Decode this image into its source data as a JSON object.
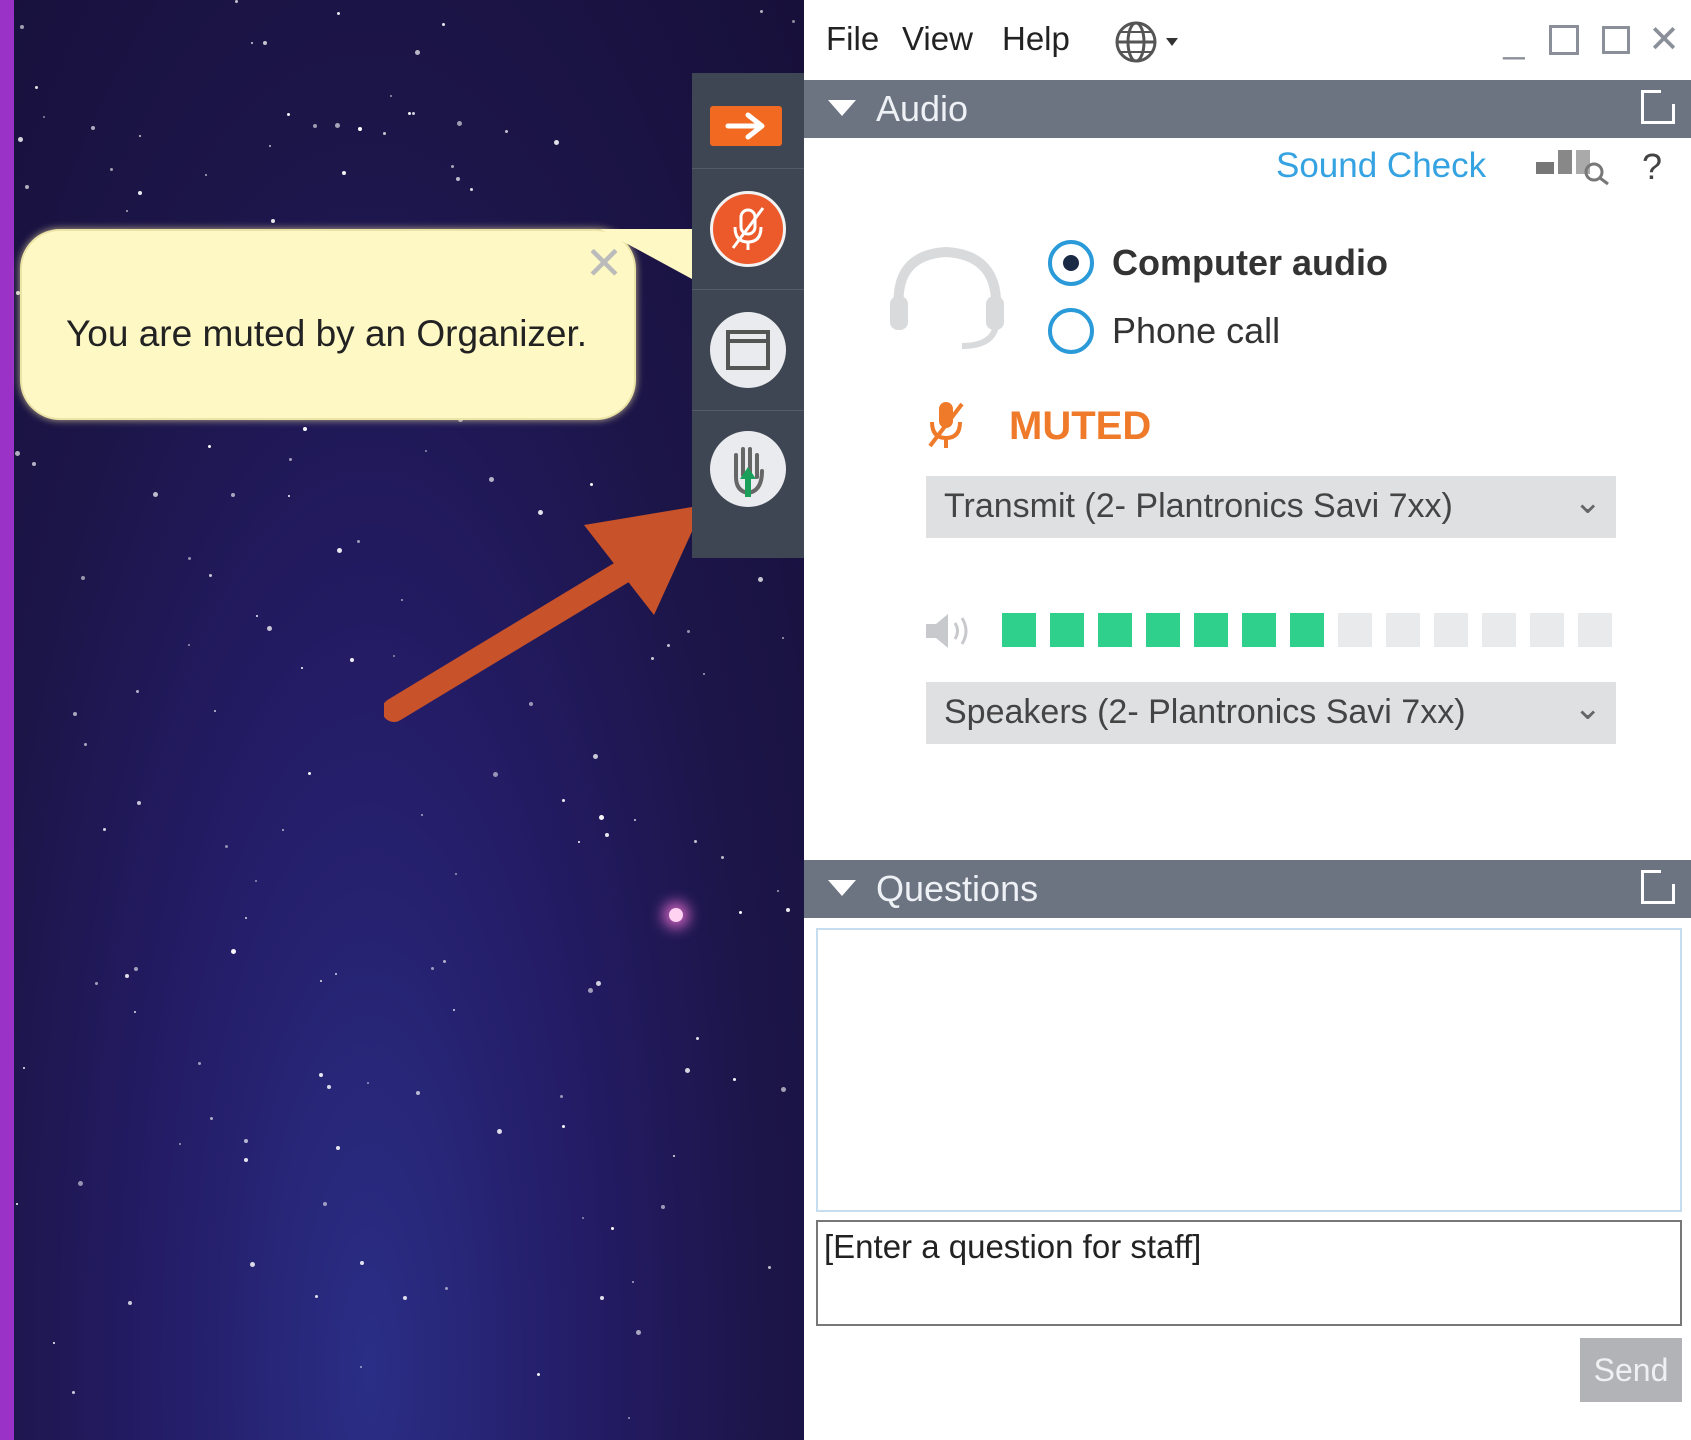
{
  "tooltip": {
    "text": "You are muted by an Organizer."
  },
  "menu": {
    "file": "File",
    "view": "View",
    "help": "Help"
  },
  "audio": {
    "title": "Audio",
    "sound_check": "Sound Check",
    "help": "?",
    "options": [
      {
        "label": "Computer audio",
        "selected": true
      },
      {
        "label": "Phone call",
        "selected": false
      }
    ],
    "muted_label": "MUTED",
    "microphone": "Transmit (2- Plantronics Savi 7xx)",
    "speakers": "Speakers (2- Plantronics Savi 7xx)",
    "speaker_level": {
      "filled": 7,
      "total": 13
    }
  },
  "questions": {
    "title": "Questions",
    "input_text": "[Enter a question for staff]",
    "send_label": "Send"
  },
  "colors": {
    "accent_orange": "#f26a21",
    "link_blue": "#35a3e2",
    "level_green": "#2fd08c",
    "section_header": "#6c7381"
  }
}
